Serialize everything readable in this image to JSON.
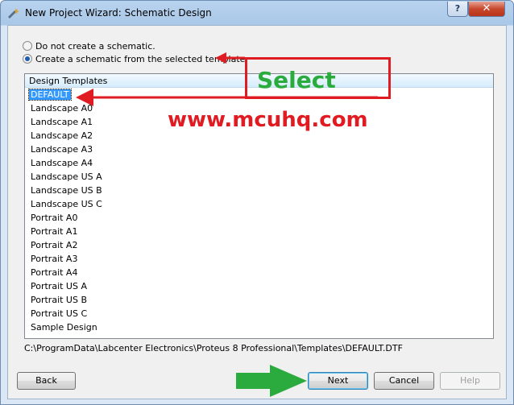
{
  "window": {
    "title": "New Project Wizard: Schematic Design",
    "help_button": "?",
    "close_button": "✕"
  },
  "options": {
    "no_schematic": "Do not create a schematic.",
    "from_template": "Create a schematic from the selected template.",
    "selected": "from_template"
  },
  "list": {
    "header": "Design Templates",
    "selected_index": 0,
    "items": [
      "DEFAULT",
      "Landscape A0",
      "Landscape A1",
      "Landscape A2",
      "Landscape A3",
      "Landscape A4",
      "Landscape US A",
      "Landscape US B",
      "Landscape US C",
      "Portrait A0",
      "Portrait A1",
      "Portrait A2",
      "Portrait A3",
      "Portrait A4",
      "Portrait US A",
      "Portrait US B",
      "Portrait US C",
      "Sample Design"
    ]
  },
  "path": "C:\\ProgramData\\Labcenter Electronics\\Proteus 8 Professional\\Templates\\DEFAULT.DTF",
  "buttons": {
    "back": "Back",
    "next": "Next",
    "cancel": "Cancel",
    "help": "Help"
  },
  "annotations": {
    "select_label": "Select",
    "watermark": "www.mcuhq.com",
    "red": "#e11b22",
    "green": "#2bab3d"
  }
}
